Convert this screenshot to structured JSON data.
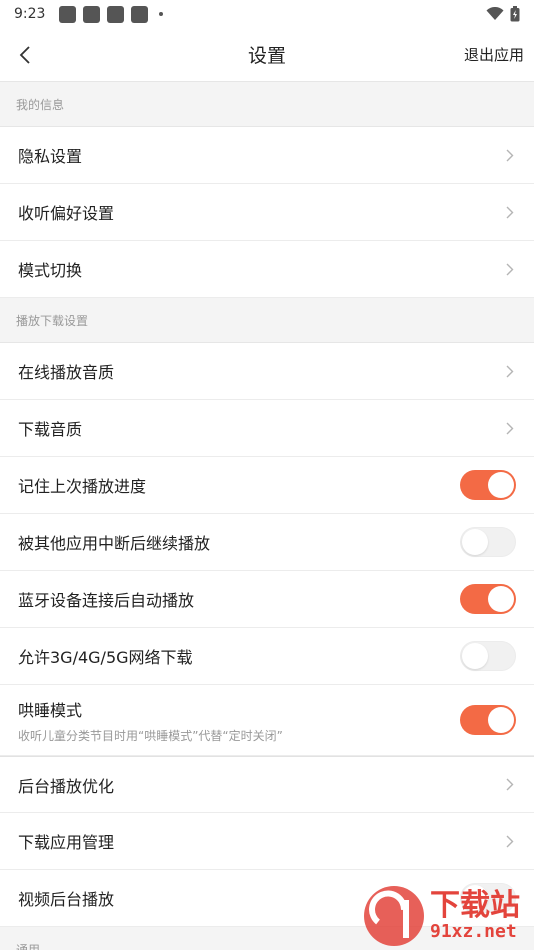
{
  "status_bar": {
    "time": "9:23"
  },
  "nav": {
    "title": "设置",
    "exit_label": "退出应用"
  },
  "sections": {
    "my_info": {
      "header": "我的信息",
      "items": [
        "隐私设置",
        "收听偏好设置",
        "模式切换"
      ]
    },
    "playback": {
      "header": "播放下载设置",
      "items": [
        {
          "label": "在线播放音质"
        },
        {
          "label": "下载音质"
        },
        {
          "label": "记住上次播放进度",
          "toggle": true
        },
        {
          "label": "被其他应用中断后继续播放",
          "toggle": false
        },
        {
          "label": "蓝牙设备连接后自动播放",
          "toggle": true
        },
        {
          "label": "允许3G/4G/5G网络下载",
          "toggle": false
        },
        {
          "label": "哄睡模式",
          "sub": "收听儿童分类节目时用“哄睡模式”代替“定时关闭”",
          "toggle": true
        }
      ]
    },
    "other": {
      "items": [
        "后台播放优化",
        "下载应用管理",
        "视频后台播放"
      ]
    },
    "general": {
      "header": "通用"
    }
  },
  "colors": {
    "accent": "#f36a45",
    "toggle_off": "#f1f1f1",
    "section_bg": "#f4f4f4"
  },
  "watermark": {
    "text": "下载站",
    "site": "91xz.net"
  }
}
